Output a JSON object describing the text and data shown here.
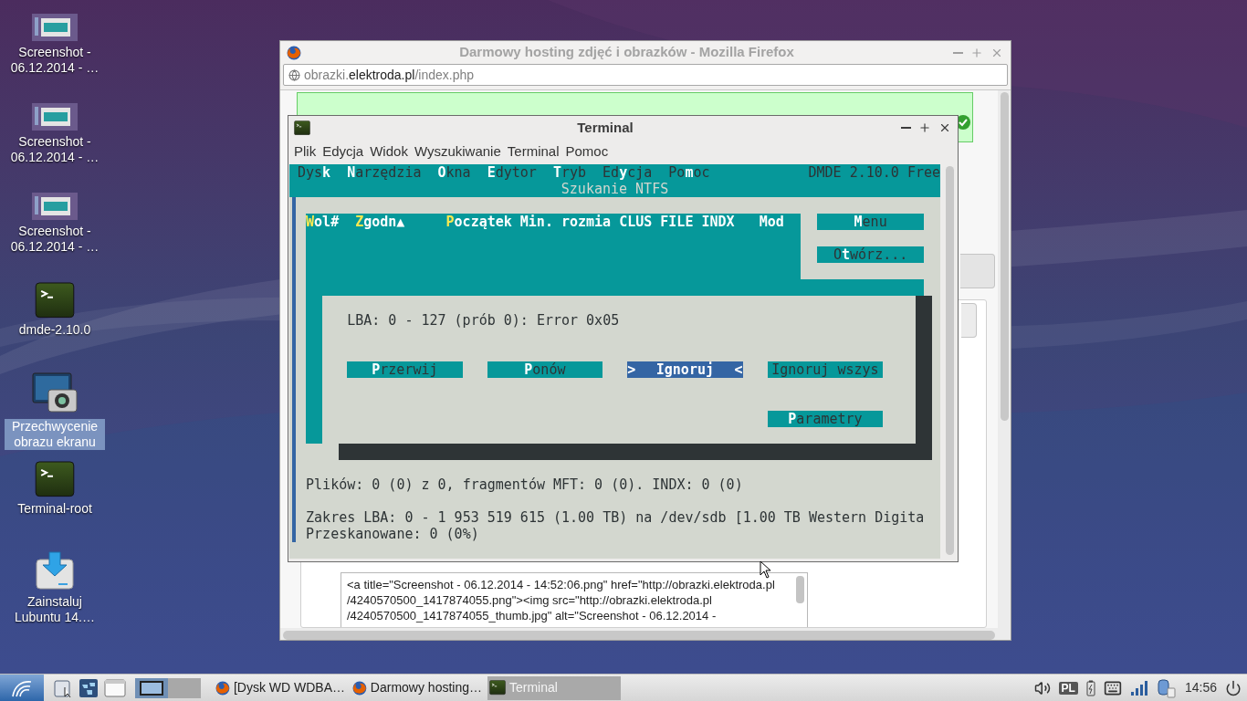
{
  "desktop_icons": [
    {
      "label": "Screenshot - 06.12.2014 - …",
      "kind": "screenshot",
      "selected": false
    },
    {
      "label": "Screenshot - 06.12.2014 - …",
      "kind": "screenshot",
      "selected": false
    },
    {
      "label": "Screenshot - 06.12.2014 - …",
      "kind": "screenshot",
      "selected": false
    },
    {
      "label": "dmde-2.10.0",
      "kind": "terminal",
      "selected": false
    },
    {
      "label": "Przechwycenie obrazu ekranu",
      "kind": "camera",
      "selected": true
    },
    {
      "label": "Terminal-root",
      "kind": "terminal",
      "selected": false
    },
    {
      "label": "Zainstaluj Lubuntu 14.…",
      "kind": "installer",
      "selected": false
    }
  ],
  "firefox": {
    "title": "Darmowy hosting zdjęć i obrazków - Mozilla Firefox",
    "url": "obrazki.**elektroda.pl**/index.php",
    "html_code": [
      "<a title=\"Screenshot - 06.12.2014 - 14:52:06.png\" href=\"http://obrazki.elektroda.pl",
      "/4240570500_1417874055.png\"><img src=\"http://obrazki.elektroda.pl",
      "/4240570500_1417874055_thumb.jpg\" alt=\"Screenshot - 06.12.2014 -"
    ]
  },
  "terminal": {
    "title": "Terminal",
    "menu": [
      "Plik",
      "Edycja",
      "Widok",
      "Wyszukiwanie",
      "Terminal",
      "Pomoc"
    ],
    "dmde": {
      "menu": [
        "Dys**k**",
        "**N**arzędzia",
        "**O**kna",
        "**E**dytor",
        "**T**ryb",
        "Ed**y**cja",
        "Po**m**oc"
      ],
      "version": "DMDE 2.10.0 Free",
      "window_title": "Szukanie NTFS",
      "columns": [
        "**W**ol#",
        "**Z**godn▲",
        "**P**oczątek",
        "Min. rozmia",
        "CLUS",
        "FILE",
        "INDX",
        "Mod"
      ],
      "side_buttons": [
        "**M**enu",
        "O**t**wórz..."
      ],
      "dialog": {
        "message": "LBA: 0 - 127 (prób 0): Error 0x05",
        "selection_marks": [
          ">",
          "<"
        ],
        "buttons": [
          {
            "label": "**P**rzerwij",
            "selected": false
          },
          {
            "label": "**P**onów",
            "selected": false
          },
          {
            "label": "Ignoruj",
            "selected": true
          },
          {
            "label": "Ignoruj wszys",
            "selected": false
          },
          {
            "label": "**P**arametry",
            "selected": false
          }
        ]
      },
      "status_lines": [
        "Plików: 0 (0) z 0, fragmentów MFT: 0 (0). INDX: 0 (0)",
        "Zakres LBA: 0 - 1 953 519 615 (1.00 TB) na /dev/sdb [1.00 TB Western Digita",
        "Przeskanowane: 0 (0%)"
      ]
    }
  },
  "taskbar": {
    "workspaces": [
      {
        "selected": true
      },
      {
        "selected": false
      }
    ],
    "tasks": [
      {
        "label": "[Dysk WD WDBA…",
        "kind": "browser",
        "selected": false
      },
      {
        "label": "Darmowy hosting…",
        "kind": "browser",
        "selected": false
      },
      {
        "label": "Terminal",
        "kind": "terminal",
        "selected": true
      }
    ],
    "keyboard_layout": "PL",
    "clock": "14:56"
  }
}
